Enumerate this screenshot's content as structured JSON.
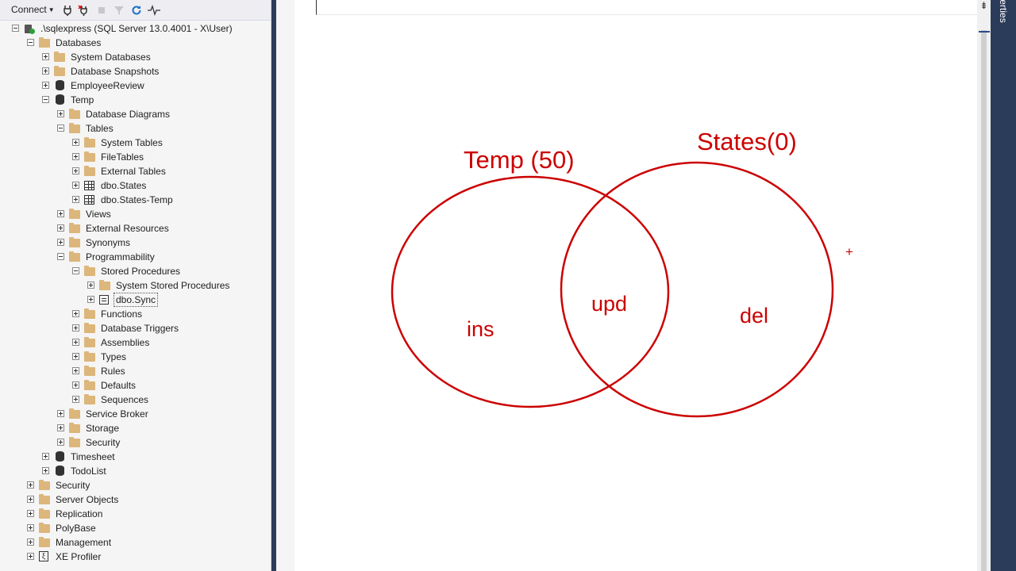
{
  "toolbar": {
    "connect_label": "Connect",
    "icons": [
      "plug-icon",
      "disconnect-icon",
      "stop-icon",
      "filter-icon",
      "refresh-icon",
      "activity-monitor-icon"
    ]
  },
  "tree": [
    {
      "label": ".\\sqlexpress (SQL Server 13.0.4001 - X\\User)",
      "icon": "server-icon",
      "exp": "minus",
      "depth": 0
    },
    {
      "label": "Databases",
      "icon": "folder-icon",
      "exp": "minus",
      "depth": 1
    },
    {
      "label": "System Databases",
      "icon": "folder-icon",
      "exp": "plus",
      "depth": 2
    },
    {
      "label": "Database Snapshots",
      "icon": "folder-icon",
      "exp": "plus",
      "depth": 2
    },
    {
      "label": "EmployeeReview",
      "icon": "database-icon",
      "exp": "plus",
      "depth": 2
    },
    {
      "label": "Temp",
      "icon": "database-icon",
      "exp": "minus",
      "depth": 2
    },
    {
      "label": "Database Diagrams",
      "icon": "folder-icon",
      "exp": "plus",
      "depth": 3
    },
    {
      "label": "Tables",
      "icon": "folder-icon",
      "exp": "minus",
      "depth": 3
    },
    {
      "label": "System Tables",
      "icon": "folder-icon",
      "exp": "plus",
      "depth": 4
    },
    {
      "label": "FileTables",
      "icon": "folder-icon",
      "exp": "plus",
      "depth": 4
    },
    {
      "label": "External Tables",
      "icon": "folder-icon",
      "exp": "plus",
      "depth": 4
    },
    {
      "label": "dbo.States",
      "icon": "table-icon",
      "exp": "plus",
      "depth": 4
    },
    {
      "label": "dbo.States-Temp",
      "icon": "table-icon",
      "exp": "plus",
      "depth": 4
    },
    {
      "label": "Views",
      "icon": "folder-icon",
      "exp": "plus",
      "depth": 3
    },
    {
      "label": "External Resources",
      "icon": "folder-icon",
      "exp": "plus",
      "depth": 3
    },
    {
      "label": "Synonyms",
      "icon": "folder-icon",
      "exp": "plus",
      "depth": 3
    },
    {
      "label": "Programmability",
      "icon": "folder-icon",
      "exp": "minus",
      "depth": 3
    },
    {
      "label": "Stored Procedures",
      "icon": "folder-icon",
      "exp": "minus",
      "depth": 4
    },
    {
      "label": "System Stored Procedures",
      "icon": "folder-icon",
      "exp": "plus",
      "depth": 5
    },
    {
      "label": "dbo.Sync",
      "icon": "stored-procedure-icon",
      "exp": "plus",
      "depth": 5,
      "selected": true
    },
    {
      "label": "Functions",
      "icon": "folder-icon",
      "exp": "plus",
      "depth": 4
    },
    {
      "label": "Database Triggers",
      "icon": "folder-icon",
      "exp": "plus",
      "depth": 4
    },
    {
      "label": "Assemblies",
      "icon": "folder-icon",
      "exp": "plus",
      "depth": 4
    },
    {
      "label": "Types",
      "icon": "folder-icon",
      "exp": "plus",
      "depth": 4
    },
    {
      "label": "Rules",
      "icon": "folder-icon",
      "exp": "plus",
      "depth": 4
    },
    {
      "label": "Defaults",
      "icon": "folder-icon",
      "exp": "plus",
      "depth": 4
    },
    {
      "label": "Sequences",
      "icon": "folder-icon",
      "exp": "plus",
      "depth": 4
    },
    {
      "label": "Service Broker",
      "icon": "folder-icon",
      "exp": "plus",
      "depth": 3
    },
    {
      "label": "Storage",
      "icon": "folder-icon",
      "exp": "plus",
      "depth": 3
    },
    {
      "label": "Security",
      "icon": "folder-icon",
      "exp": "plus",
      "depth": 3
    },
    {
      "label": "Timesheet",
      "icon": "database-icon",
      "exp": "plus",
      "depth": 2
    },
    {
      "label": "TodoList",
      "icon": "database-icon",
      "exp": "plus",
      "depth": 2
    },
    {
      "label": "Security",
      "icon": "folder-icon",
      "exp": "plus",
      "depth": 1
    },
    {
      "label": "Server Objects",
      "icon": "folder-icon",
      "exp": "plus",
      "depth": 1
    },
    {
      "label": "Replication",
      "icon": "folder-icon",
      "exp": "plus",
      "depth": 1
    },
    {
      "label": "PolyBase",
      "icon": "folder-icon",
      "exp": "plus",
      "depth": 1
    },
    {
      "label": "Management",
      "icon": "folder-icon",
      "exp": "plus",
      "depth": 1
    },
    {
      "label": "XE Profiler",
      "icon": "xe-profiler-icon",
      "exp": "plus",
      "depth": 1
    }
  ],
  "diagram": {
    "left_title": "Temp (50)",
    "right_title": "States(0)",
    "left_region": "ins",
    "middle_region": "upd",
    "right_region": "del",
    "cursor_glyph": "+",
    "stroke_color": "#cc0000"
  },
  "right_panel": {
    "tab_label": "Properties"
  },
  "scrollbar": {
    "top_glyph": "⇟"
  }
}
